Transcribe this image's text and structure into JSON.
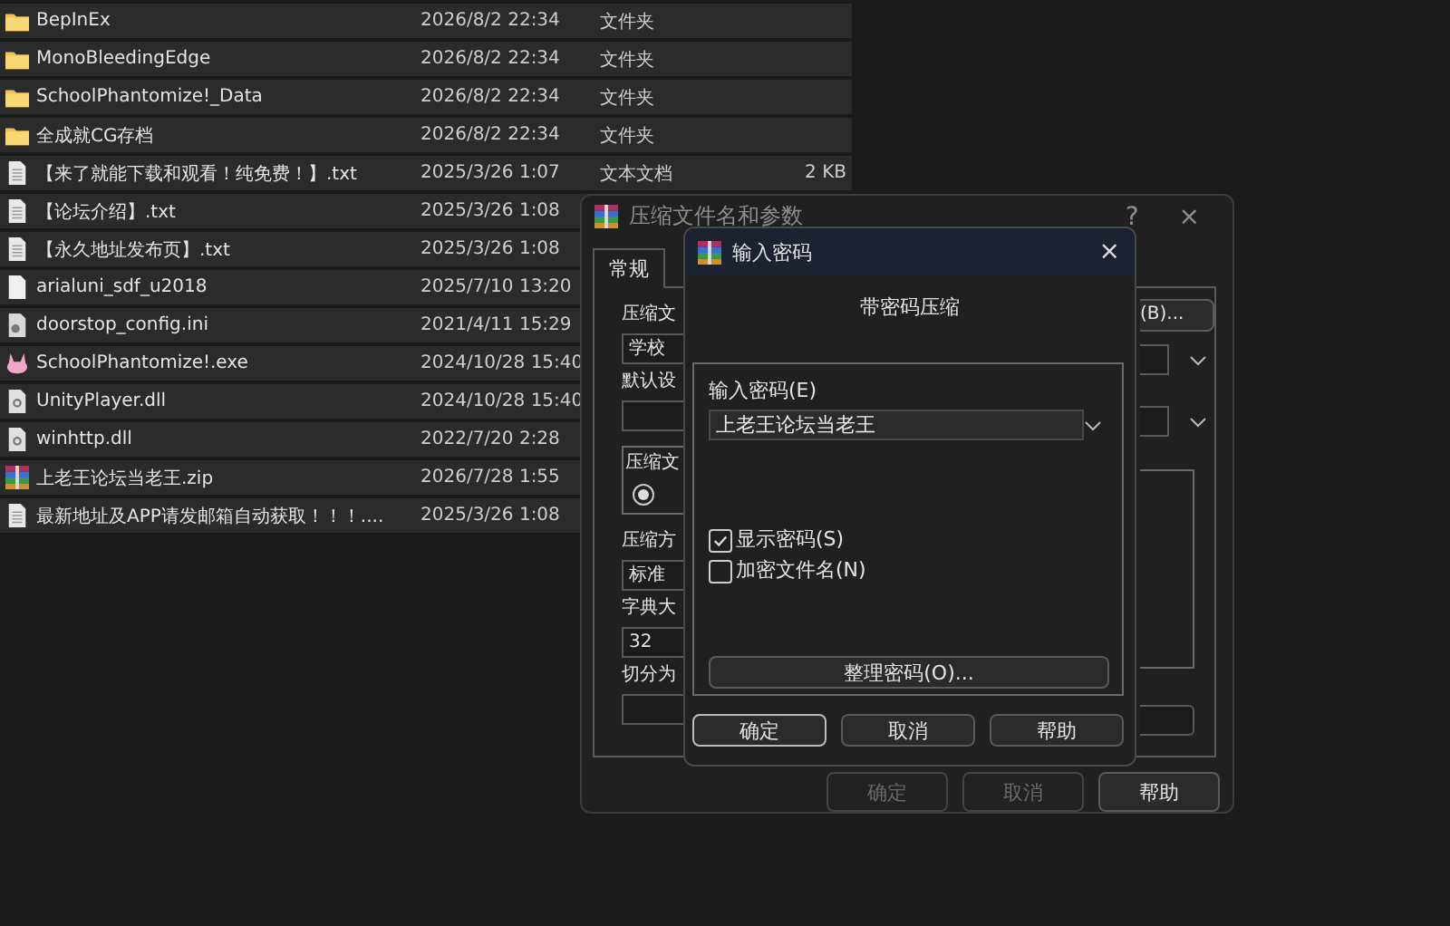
{
  "file_list": {
    "rows": [
      {
        "kind": "folder",
        "name": "BepInEx",
        "date": "2026/8/2 22:34",
        "type": "文件夹"
      },
      {
        "kind": "folder",
        "name": "MonoBleedingEdge",
        "date": "2026/8/2 22:34",
        "type": "文件夹"
      },
      {
        "kind": "folder",
        "name": "SchoolPhantomize!_Data",
        "date": "2026/8/2 22:34",
        "type": "文件夹"
      },
      {
        "kind": "folder",
        "name": "全成就CG存档",
        "date": "2026/8/2 22:34",
        "type": "文件夹"
      },
      {
        "kind": "text",
        "name": "【来了就能下载和观看！纯免费！】.txt",
        "date": "2025/3/26 1:07",
        "type": "文本文档",
        "size": "2 KB"
      },
      {
        "kind": "text",
        "name": "【论坛介绍】.txt",
        "date": "2025/3/26 1:08"
      },
      {
        "kind": "text",
        "name": "【永久地址发布页】.txt",
        "date": "2025/3/26 1:08"
      },
      {
        "kind": "blank",
        "name": "arialuni_sdf_u2018",
        "date": "2025/7/10 13:20"
      },
      {
        "kind": "config",
        "name": "doorstop_config.ini",
        "date": "2021/4/11 15:29"
      },
      {
        "kind": "exe",
        "name": "SchoolPhantomize!.exe",
        "date": "2024/10/28 15:40"
      },
      {
        "kind": "dll",
        "name": "UnityPlayer.dll",
        "date": "2024/10/28 15:40"
      },
      {
        "kind": "dll",
        "name": "winhttp.dll",
        "date": "2022/7/20 2:28"
      },
      {
        "kind": "zip",
        "name": "上老王论坛当老王.zip",
        "date": "2026/7/28 1:55"
      },
      {
        "kind": "text",
        "name": "最新地址及APP请发邮箱自动获取！！！....",
        "date": "2025/3/26 1:08"
      }
    ]
  },
  "archive_dialog": {
    "title": "压缩文件名和参数",
    "help": "?",
    "close": "×",
    "tabs": [
      {
        "label": "常规",
        "selected": true
      }
    ],
    "left_items": [
      {
        "kind": "label",
        "text": "压缩文"
      },
      {
        "kind": "field",
        "text": "学校"
      },
      {
        "kind": "label",
        "text": "默认设"
      },
      {
        "kind": "field"
      },
      {
        "kind": "group",
        "text": "压缩文",
        "selected": true
      },
      {
        "kind": "label",
        "text": "压缩方"
      },
      {
        "kind": "field",
        "text": "标准"
      },
      {
        "kind": "label",
        "text": "字典大"
      },
      {
        "kind": "field",
        "text": "32"
      },
      {
        "kind": "label",
        "text": "切分为"
      },
      {
        "kind": "field"
      }
    ],
    "right_items": [
      {
        "kind": "button",
        "text": "(B)..."
      },
      {
        "kind": "combo"
      },
      {
        "kind": "combo"
      },
      {
        "kind": "group"
      },
      {
        "kind": "field"
      }
    ],
    "buttons": [
      {
        "label": "确定",
        "disabled": true
      },
      {
        "label": "取消",
        "disabled": true
      },
      {
        "label": "帮助",
        "disabled": false
      }
    ]
  },
  "password_dialog": {
    "title": "输入密码",
    "close": "×",
    "heading": "带密码压缩",
    "password_label": "输入密码(E)",
    "password": "上老王论坛当老王",
    "options": [
      {
        "label": "显示密码(S)",
        "checked": true
      },
      {
        "label": "加密文件名(N)",
        "checked": false
      }
    ],
    "organize_button": "整理密码(O)...",
    "buttons": [
      {
        "label": "确定",
        "focused": true
      },
      {
        "label": "取消",
        "focused": false
      },
      {
        "label": "帮助",
        "focused": false
      }
    ]
  }
}
